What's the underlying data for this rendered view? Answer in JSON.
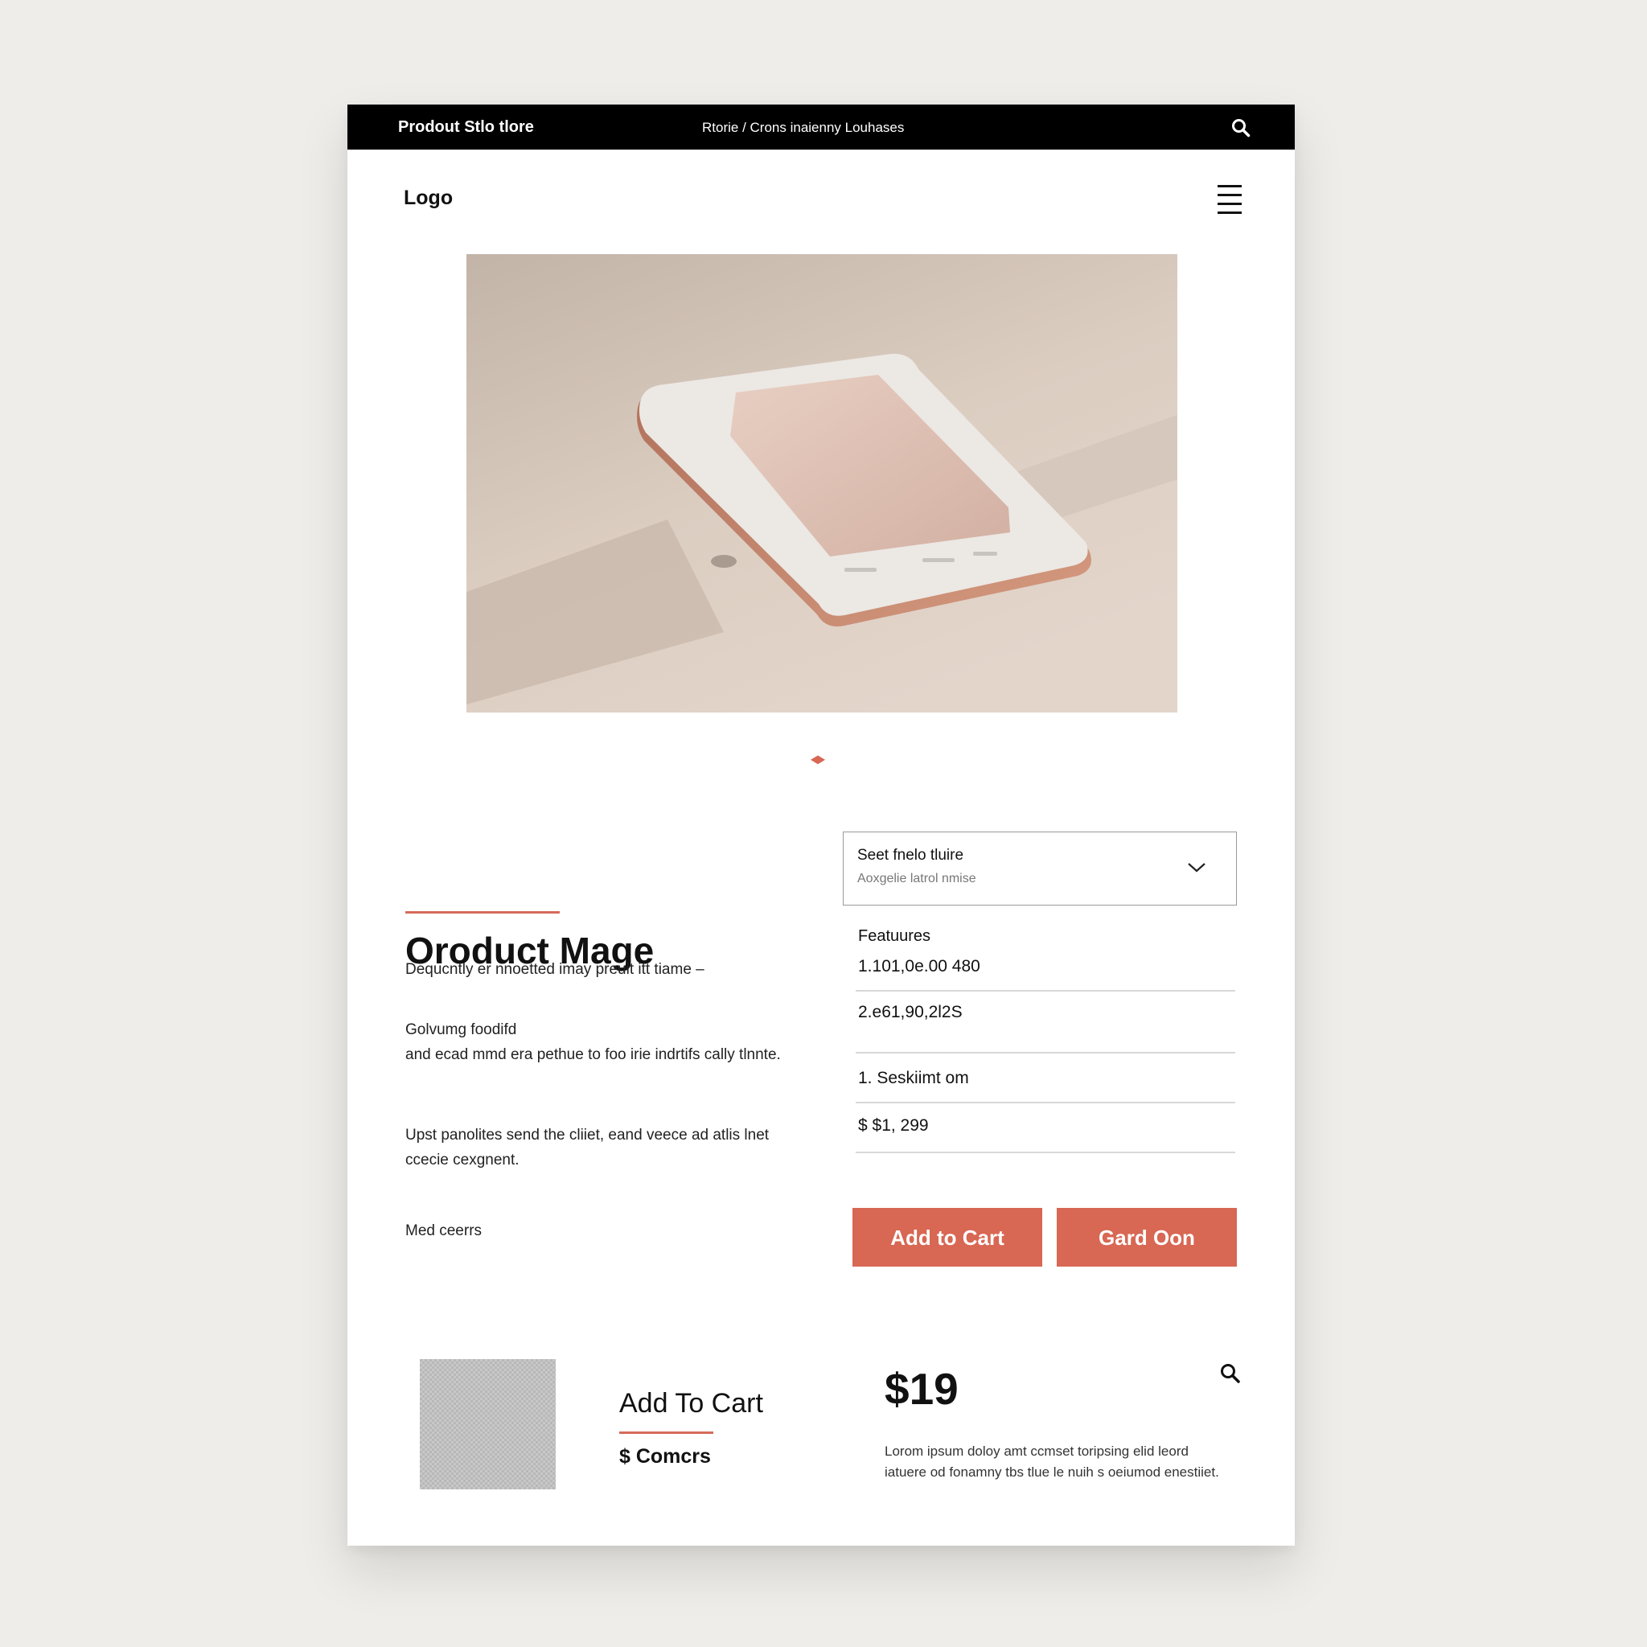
{
  "topbar": {
    "store_name": "Prodout Stlo tlore",
    "breadcrumb": "Rtorie  /  Crons inaienny Louhases"
  },
  "header": {
    "logo": "Logo"
  },
  "product": {
    "title": "Oroduct Mage",
    "description": [
      "Dequcntly er nnoetted imay preuit itt tiame  –",
      "Golvumg foodifd\nand ecad mmd era pethue to foo irie indrtifs cally tlnnte.",
      "Upst panolites send the cliiet, eand veece ad atlis lnet ccecie cexgnent.",
      "Med ceerrs"
    ]
  },
  "select": {
    "value": "Seet fnelo tluire",
    "hint": "Aoxgelie latrol nmise"
  },
  "features": {
    "label": "Featuures",
    "rows": [
      "1.101,0e.00 480",
      "2.e61,90,2l2S",
      "1. Seskiimt om",
      "$ $1, 299"
    ]
  },
  "buttons": {
    "add_to_cart": "Add to Cart",
    "card_oon": "Gard Oon"
  },
  "bottom": {
    "cart_title": "Add To Cart",
    "sub": "$ Comcrs",
    "price": "$19",
    "description": "Lorom ipsum doloy amt ccmset toripsing elid leord iatuere od fonamny tbs tlue le nuih s oeiumod enestiiet."
  },
  "colors": {
    "accent": "#d86753",
    "topbar": "#000000",
    "background": "#eeede9"
  },
  "icons": [
    "search-icon",
    "menu-icon",
    "chevron-down-icon",
    "carousel-dot-icon"
  ]
}
